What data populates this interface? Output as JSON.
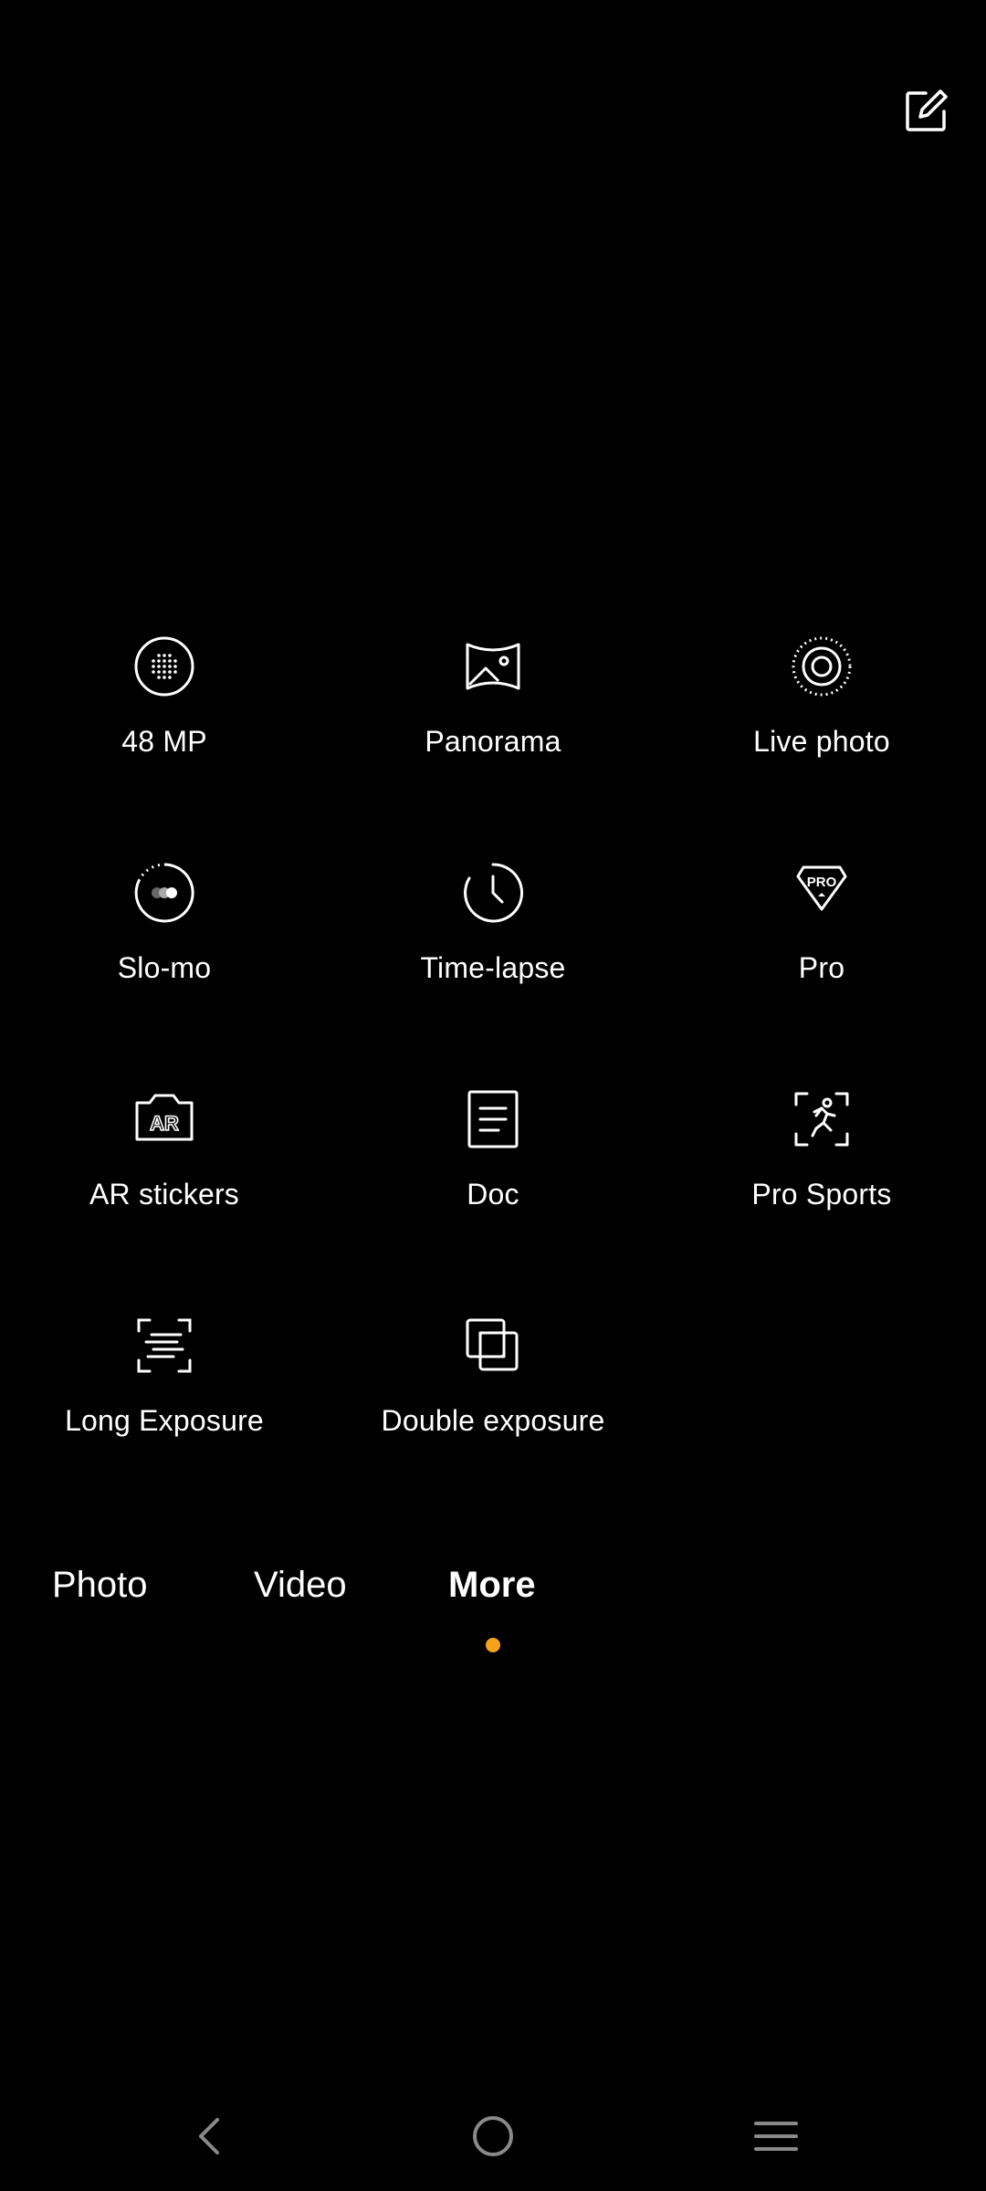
{
  "colors": {
    "background": "#000000",
    "text": "#ffffff",
    "accent": "#f7a21b",
    "nav_icon": "#8a8a8a"
  },
  "header": {
    "edit_icon": "edit-icon"
  },
  "modes": [
    {
      "label": "48 MP",
      "icon": "48mp-icon"
    },
    {
      "label": "Panorama",
      "icon": "panorama-icon"
    },
    {
      "label": "Live photo",
      "icon": "live-photo-icon"
    },
    {
      "label": "Slo-mo",
      "icon": "slo-mo-icon"
    },
    {
      "label": "Time-lapse",
      "icon": "time-lapse-icon"
    },
    {
      "label": "Pro",
      "icon": "pro-icon"
    },
    {
      "label": "AR stickers",
      "icon": "ar-stickers-icon"
    },
    {
      "label": "Doc",
      "icon": "doc-icon"
    },
    {
      "label": "Pro Sports",
      "icon": "pro-sports-icon"
    },
    {
      "label": "Long Exposure",
      "icon": "long-exposure-icon"
    },
    {
      "label": "Double exposure",
      "icon": "double-exposure-icon"
    }
  ],
  "tabs": [
    {
      "label": "Photo",
      "active": false
    },
    {
      "label": "Video",
      "active": false
    },
    {
      "label": "More",
      "active": true
    }
  ],
  "navbar": {
    "back_icon": "back-icon",
    "home_icon": "home-icon",
    "menu_icon": "menu-icon"
  },
  "pro_icon_text": "PRO",
  "ar_icon_text": "AR"
}
